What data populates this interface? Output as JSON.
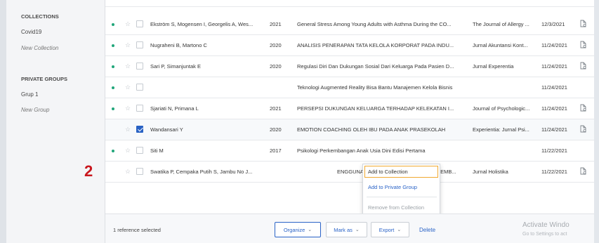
{
  "sidebar": {
    "collections_header": "COLLECTIONS",
    "collections": [
      {
        "label": "Covid19",
        "italic": false
      },
      {
        "label": "New Collection",
        "italic": true
      }
    ],
    "groups_header": "PRIVATE GROUPS",
    "groups": [
      {
        "label": "Grup 1",
        "italic": false
      },
      {
        "label": "New Group",
        "italic": true
      }
    ]
  },
  "rows": [
    {
      "authors": "Ekström S, Mogensen I, Georgelis A, Wes...",
      "year": "2021",
      "title": "General Stress Among Young Adults with Asthma During the CO...",
      "journal": "The Journal of Allergy ...",
      "date": "12/3/2021",
      "dot": true,
      "checked": false,
      "file": true
    },
    {
      "authors": "Nugraheni B, Martono C",
      "year": "2020",
      "title": "ANALISIS PENERAPAN TATA KELOLA KORPORAT PADA INDU...",
      "journal": "Jurnal Akuntansi Kont...",
      "date": "11/24/2021",
      "dot": true,
      "checked": false,
      "file": true
    },
    {
      "authors": "Sari P, Simanjuntak E",
      "year": "2020",
      "title": "Regulasi Diri Dan Dukungan Sosial Dari Keluarga Pada Pasien D...",
      "journal": "Jurnal Experentia",
      "date": "11/24/2021",
      "dot": true,
      "checked": false,
      "file": true
    },
    {
      "authors": "",
      "year": "",
      "title": "Teknologi Augmented Reality Bisa Bantu Manajemen Kelola Bisnis",
      "journal": "",
      "date": "11/24/2021",
      "dot": true,
      "checked": false,
      "file": false
    },
    {
      "authors": "Sjariati N, Primana L",
      "year": "2021",
      "title": "PERSEPSI DUKUNGAN KELUARGA TERHADAP KELEKATAN I...",
      "journal": "Journal of Psychologic...",
      "date": "11/24/2021",
      "dot": true,
      "checked": false,
      "file": true
    },
    {
      "authors": "Wandansari Y",
      "year": "2020",
      "title": "EMOTION COACHING OLEH IBU PADA ANAK PRASEKOLAH",
      "journal": "Experientia: Jurnal Psi...",
      "date": "11/24/2021",
      "dot": false,
      "checked": true,
      "file": true
    },
    {
      "authors": "Siti M",
      "year": "2017",
      "title": "Psikologi Perkembangan Anak Usia Dini Edisi Pertama",
      "journal": "",
      "date": "11/22/2021",
      "dot": true,
      "checked": false,
      "file": false
    },
    {
      "authors": "Swatika P, Cempaka Putih S, Jambu No J...",
      "year": "",
      "title": "ENGGUNAAN GADGET TERHADAP PERKEMB...",
      "journal": "Jurnal Holistika",
      "date": "11/22/2021",
      "dot": false,
      "checked": false,
      "file": true
    }
  ],
  "context_menu": {
    "add_to_collection": "Add to Collection",
    "add_to_private_group": "Add to Private Group",
    "remove_from_collection": "Remove from Collection"
  },
  "footer": {
    "selected_text": "1 reference selected",
    "organize": "Organize",
    "mark_as": "Mark as",
    "export": "Export",
    "delete": "Delete"
  },
  "watermark": {
    "line1": "Activate Windo",
    "line2": "Go to Settings to act"
  },
  "annotation_number": "2",
  "colors": {
    "accent": "#2a63c7",
    "dot": "#21a67a",
    "annotation": "#c9171e",
    "highlight": "#f0a830"
  }
}
